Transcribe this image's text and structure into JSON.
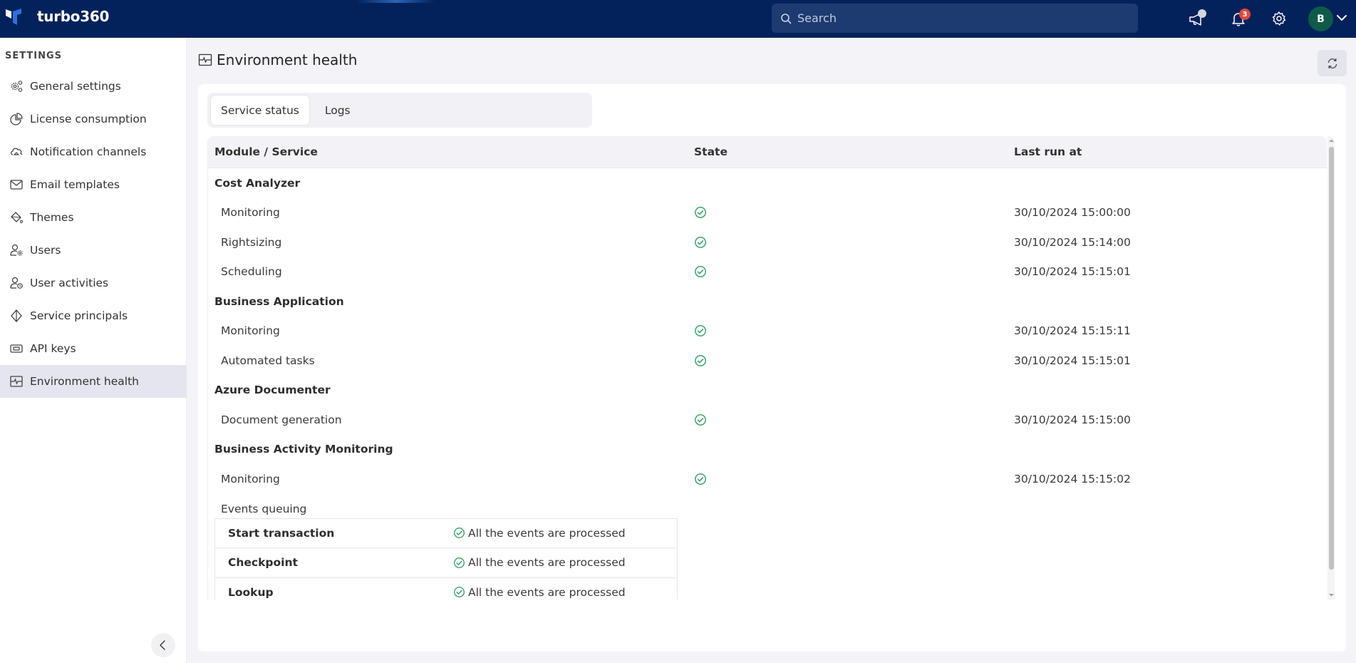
{
  "app": {
    "brand": "turbo360",
    "search_placeholder": "Search",
    "notification_count": "3",
    "avatar_initial": "B",
    "colors": {
      "topbar": "#03225c",
      "success": "#3aa76d",
      "badge": "#e2483d",
      "avatar": "#0f5a48"
    }
  },
  "sidebar": {
    "heading": "SETTINGS",
    "items": [
      {
        "label": "General settings",
        "icon": "gears-icon"
      },
      {
        "label": "License consumption",
        "icon": "pie-chart-icon"
      },
      {
        "label": "Notification channels",
        "icon": "cloud-bell-icon"
      },
      {
        "label": "Email templates",
        "icon": "envelope-icon"
      },
      {
        "label": "Themes",
        "icon": "paint-bucket-icon"
      },
      {
        "label": "Users",
        "icon": "user-settings-icon"
      },
      {
        "label": "User activities",
        "icon": "user-clock-icon"
      },
      {
        "label": "Service principals",
        "icon": "diamond-icon"
      },
      {
        "label": "API keys",
        "icon": "api-key-icon"
      },
      {
        "label": "Environment health",
        "icon": "pulse-monitor-icon",
        "active": true
      }
    ]
  },
  "page": {
    "title": "Environment health",
    "tabs": [
      {
        "label": "Service status",
        "active": true
      },
      {
        "label": "Logs",
        "active": false
      }
    ],
    "table": {
      "columns": [
        "Module / Service",
        "State",
        "Last run at"
      ],
      "groups": [
        {
          "module": "Cost Analyzer",
          "services": [
            {
              "name": "Monitoring",
              "state": "healthy",
              "last_run": "30/10/2024 15:00:00"
            },
            {
              "name": "Rightsizing",
              "state": "healthy",
              "last_run": "30/10/2024 15:14:00"
            },
            {
              "name": "Scheduling",
              "state": "healthy",
              "last_run": "30/10/2024 15:15:01"
            }
          ]
        },
        {
          "module": "Business Application",
          "services": [
            {
              "name": "Monitoring",
              "state": "healthy",
              "last_run": "30/10/2024 15:15:11"
            },
            {
              "name": "Automated tasks",
              "state": "healthy",
              "last_run": "30/10/2024 15:15:01"
            }
          ]
        },
        {
          "module": "Azure Documenter",
          "services": [
            {
              "name": "Document generation",
              "state": "healthy",
              "last_run": "30/10/2024 15:15:00"
            }
          ]
        },
        {
          "module": "Business Activity Monitoring",
          "services": [
            {
              "name": "Monitoring",
              "state": "healthy",
              "last_run": "30/10/2024 15:15:02"
            }
          ]
        }
      ],
      "events_queuing": {
        "label": "Events queuing",
        "items": [
          {
            "name": "Start transaction",
            "status": "All the events are processed"
          },
          {
            "name": "Checkpoint",
            "status": "All the events are processed"
          },
          {
            "name": "Lookup",
            "status": "All the events are processed"
          }
        ]
      }
    }
  }
}
